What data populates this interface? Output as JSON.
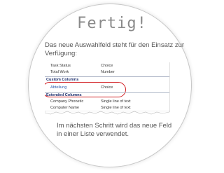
{
  "title": "Fertig!",
  "intro_text": "Das neue Auswahlfeld steht für den Einsatz zur Verfügung:",
  "outro_text": "Im nächsten Schritt wird das neue Feld in einer Liste verwendet.",
  "snippet": {
    "rows": [
      {
        "name": "Task Status",
        "type": "Choice"
      },
      {
        "name": "Total Work",
        "type": "Number"
      }
    ],
    "custom_section": "Custom Columns",
    "custom_rows": [
      {
        "name": "Abteilung",
        "type": "Choice"
      }
    ],
    "extended_section": "Extended Columns",
    "extended_rows": [
      {
        "name": "Company Phonetic",
        "type": "Single line of text"
      },
      {
        "name": "Computer Name",
        "type": "Single line of text"
      }
    ]
  },
  "colors": {
    "highlight": "#d21f24",
    "title": "#8a8a8a",
    "section_heading": "#1c2f6e",
    "link": "#2a5db0"
  }
}
